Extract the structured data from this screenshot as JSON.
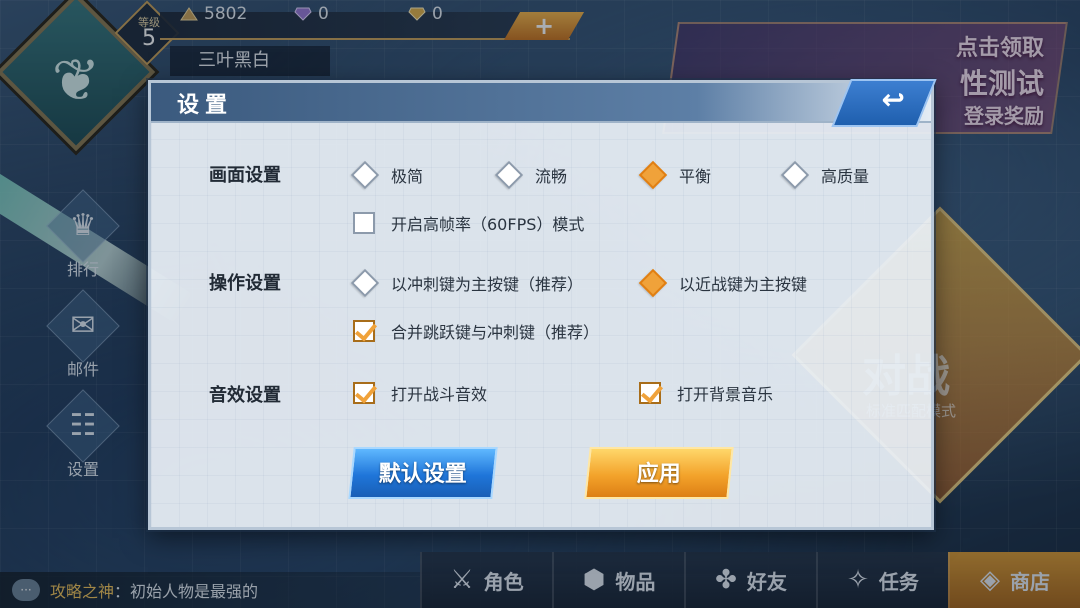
{
  "background": {
    "promo": {
      "line1": "点击领取",
      "line2": "性测试",
      "line3": "登录奖励"
    },
    "battle": {
      "title": "对战",
      "subtitle": "标准匹配模式"
    }
  },
  "player": {
    "level_label": "等级",
    "level": "5",
    "name": "三叶黑白",
    "currency": [
      {
        "icon": "triangle-coin-icon",
        "value": "5802"
      },
      {
        "icon": "purple-gem-icon",
        "value": "0"
      },
      {
        "icon": "gold-gem-icon",
        "value": "0"
      }
    ],
    "add_label": "+"
  },
  "side_nav": [
    {
      "name": "ranking",
      "icon": "crown-icon",
      "glyph": "♛",
      "label": "排行"
    },
    {
      "name": "mail",
      "icon": "envelope-icon",
      "glyph": "✉",
      "label": "邮件"
    },
    {
      "name": "settings",
      "icon": "clipboard-icon",
      "glyph": "☷",
      "label": "设置"
    }
  ],
  "dialog": {
    "title": "设置",
    "graphics": {
      "label": "画面设置",
      "options": [
        "极简",
        "流畅",
        "平衡",
        "高质量"
      ],
      "selected": "平衡",
      "high_fps": {
        "label": "开启高帧率（60FPS）模式",
        "checked": false
      }
    },
    "controls": {
      "label": "操作设置",
      "options": [
        "以冲刺键为主按键（推荐）",
        "以近战键为主按键"
      ],
      "selected": "以近战键为主按键",
      "merge_jump": {
        "label": "合并跳跃键与冲刺键（推荐）",
        "checked": true
      }
    },
    "audio": {
      "label": "音效设置",
      "battle_sfx": {
        "label": "打开战斗音效",
        "checked": true
      },
      "bgm": {
        "label": "打开背景音乐",
        "checked": true
      }
    },
    "buttons": {
      "default": "默认设置",
      "apply": "应用"
    }
  },
  "bottom_nav": [
    {
      "icon": "character-icon",
      "glyph": "⚔",
      "label": "角色"
    },
    {
      "icon": "cube-icon",
      "glyph": "⬢",
      "label": "物品"
    },
    {
      "icon": "clover-icon",
      "glyph": "✤",
      "label": "好友"
    },
    {
      "icon": "wings-icon",
      "glyph": "✧",
      "label": "任务"
    },
    {
      "icon": "shop-icon",
      "glyph": "◈",
      "label": "商店",
      "active": true
    }
  ],
  "chat": {
    "icon": "chat-bubble-icon",
    "user": "攻略之神",
    "message": "：初始人物是最强的"
  },
  "colors": {
    "accent_orange": "#f0a23a",
    "accent_blue": "#1f75d9",
    "header_blue": "#3b5a7e"
  }
}
